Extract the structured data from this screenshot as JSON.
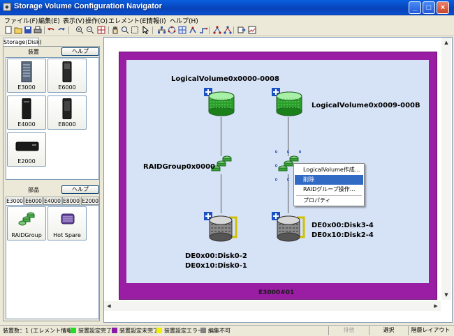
{
  "window": {
    "title": "Storage Volume Configuration Navigator"
  },
  "menu": [
    "ファイル(F)",
    "編集(E)",
    "表示(V)",
    "操作(O)",
    "エレメント(E)",
    "情報(I)",
    "ヘルプ(H)"
  ],
  "left_panel": {
    "tab": "Storage(Disk)",
    "devices": {
      "title": "装置",
      "help": "ヘルプ",
      "items": [
        "E3000",
        "E6000",
        "E4000",
        "E8000",
        "E2000"
      ]
    },
    "parts": {
      "title": "部品",
      "help": "ヘルプ",
      "tabs": [
        "E3000",
        "E6000",
        "E4000",
        "E8000",
        "E2000"
      ],
      "items": [
        "RAIDGroup",
        "Hot Spare"
      ]
    }
  },
  "canvas": {
    "enclosure_label": "E3000#01",
    "volume_left": "LogicalVolume0x0000-0008",
    "volume_right": "LogicalVolume0x0009-000B",
    "raid_left": "RAIDGroup0x0000",
    "disk_left": [
      "DE0x00:Disk0-2",
      "DE0x10:Disk0-1"
    ],
    "disk_right": [
      "DE0x00:Disk3-4",
      "DE0x10:Disk2-4"
    ]
  },
  "context_menu": {
    "items": [
      "LogicalVolume作成...",
      "削除",
      "RAIDグループ操作...",
      "プロパティ"
    ],
    "selected": "削除"
  },
  "status": {
    "count": "装置数：1",
    "info": "(エレメント情報)",
    "legend": [
      {
        "label": "装置設定完了",
        "color": "#22dd22"
      },
      {
        "label": "装置設定未完了",
        "color": "#8a1aa8"
      },
      {
        "label": "装置設定エラー",
        "color": "#f0f000"
      },
      {
        "label": "編集不可",
        "color": "#808080"
      }
    ],
    "mode_disabled": "排他",
    "mode": "選択",
    "layout": "階層レイアウト"
  },
  "colors": {
    "accent": "#316ac5",
    "enclosure": "#9a1ea4",
    "canvas_bg": "#d6e2f5"
  }
}
